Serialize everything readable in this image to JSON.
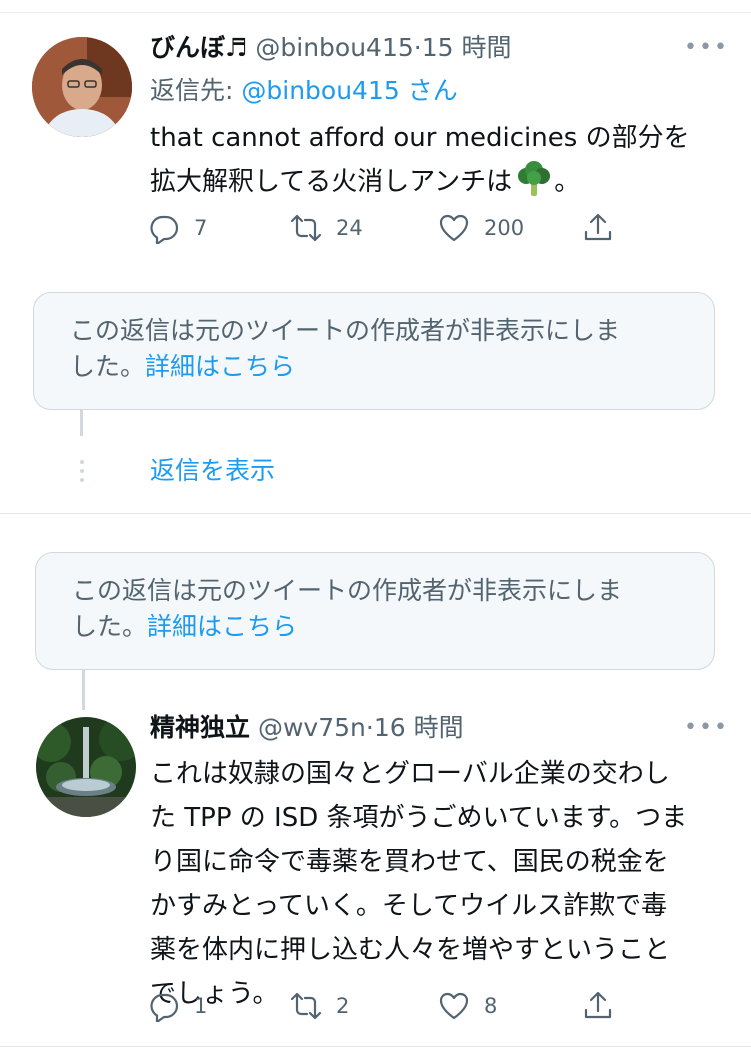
{
  "tweet1": {
    "display_name": "びんぼ♬",
    "handle": "@binbou415",
    "separator": "·",
    "time": "15 時間",
    "reply_label": "返信先: ",
    "reply_handle": "@binbou415",
    "reply_suffix": " さん",
    "text_line1": "that cannot  afford our medicines の部分を",
    "text_line2": "拡大解釈してる火消しアンチは",
    "text_emoji": "🥦",
    "text_end": "。",
    "replies": "7",
    "retweets": "24",
    "likes": "200"
  },
  "hidden_notice1": {
    "line1": "この返信は元のツイートの作成者が非表示にしま",
    "line2_prefix": "した。",
    "link": "詳細はこちら"
  },
  "show_replies": "返信を表示",
  "hidden_notice2": {
    "line1": "この返信は元のツイートの作成者が非表示にしま",
    "line2_prefix": "した。",
    "link": "詳細はこちら"
  },
  "tweet2": {
    "display_name": "精神独立",
    "handle": "@wv75n",
    "separator": "·",
    "time": "16 時間",
    "lines": [
      "これは奴隷の国々とグローバル企業の交わし",
      "た TPP の ISD 条項がうごめいています。つま",
      "り国に命令で毒薬を買わせて、国民の税金を",
      "かすみとっていく。そしてウイルス詐欺で毒",
      "薬を体内に押し込む人々を増やすということ",
      "でしょう。"
    ],
    "replies": "1",
    "retweets": "2",
    "likes": "8"
  },
  "colors": {
    "link_blue": "#1d9bf0",
    "secondary_text": "#536471",
    "border": "#cfd9de"
  }
}
